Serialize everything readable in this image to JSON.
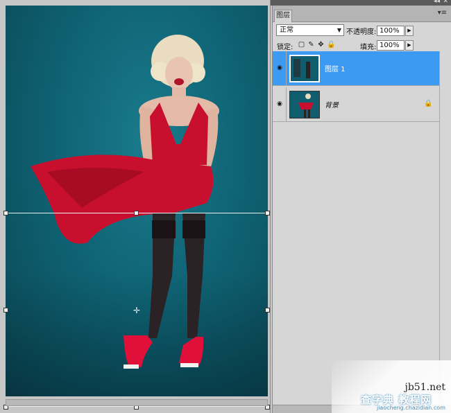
{
  "layers_panel": {
    "tab_title": "图层",
    "blend_mode": "正常",
    "opacity_label": "不透明度:",
    "opacity_value": "100%",
    "lock_label": "锁定:",
    "fill_label": "填充:",
    "fill_value": "100%",
    "layers": [
      {
        "name": "图层 1",
        "selected": true,
        "visible": true,
        "locked": false
      },
      {
        "name": "背景",
        "selected": false,
        "visible": true,
        "locked": true
      }
    ]
  },
  "watermark": {
    "site": "jb51.net",
    "slogan": "查字典 教程网",
    "url": "jiaocheng.chazidian.com"
  },
  "colors": {
    "selection": "#3c9af2",
    "backdrop": "#0f6374",
    "dress": "#c8102e"
  }
}
